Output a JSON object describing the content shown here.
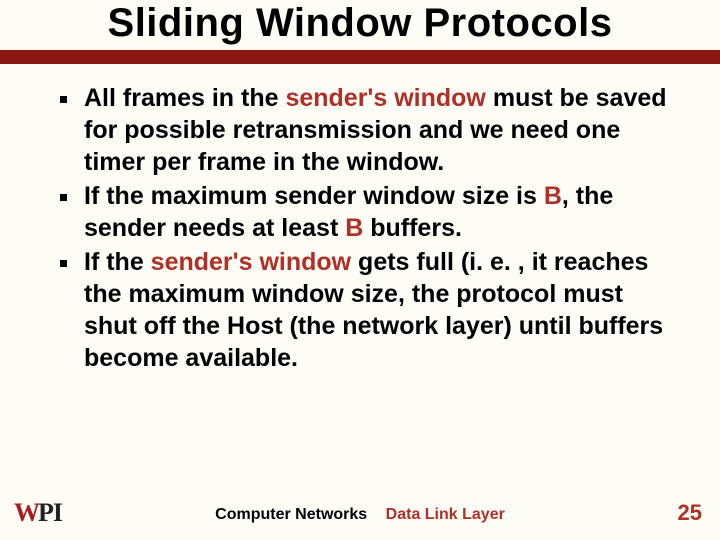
{
  "title": "Sliding Window Protocols",
  "bullets": [
    {
      "segments": [
        {
          "t": "All frames in the "
        },
        {
          "t": "sender's window",
          "hl": true
        },
        {
          "t": " must be saved for possible retransmission and we need one timer per frame in the window."
        }
      ]
    },
    {
      "segments": [
        {
          "t": "If the maximum sender window size is "
        },
        {
          "t": "B",
          "hl": true
        },
        {
          "t": ", the sender needs at least "
        },
        {
          "t": "B",
          "hl": true
        },
        {
          "t": " buffers."
        }
      ]
    },
    {
      "segments": [
        {
          "t": "If the "
        },
        {
          "t": "sender's window",
          "hl": true
        },
        {
          "t": " gets full (i. e. , it reaches the maximum window size, the protocol must shut off the Host (the network layer) until buffers become available."
        }
      ]
    }
  ],
  "footer": {
    "logo_w": "W",
    "logo_pi": "PI",
    "center_a": "Computer Networks",
    "center_b": "Data Link Layer",
    "page": "25"
  },
  "colors": {
    "accent": "#b03028",
    "bar": "#8a1612",
    "bg": "#fdfdf5"
  }
}
